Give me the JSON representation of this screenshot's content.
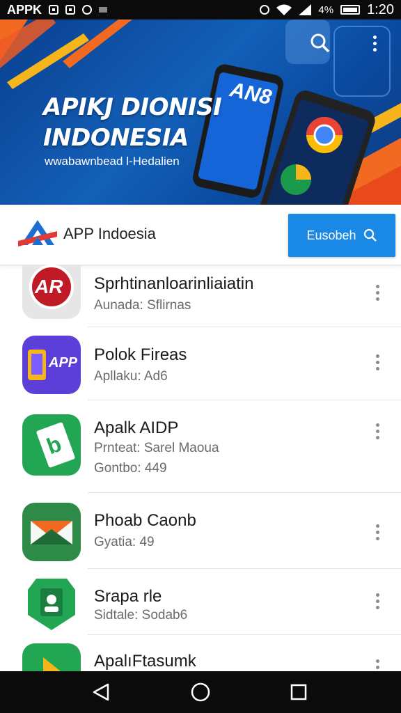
{
  "status_bar": {
    "carrier_label": "APPK",
    "icon_names": [
      "gallery-icon",
      "sim-icon",
      "sync-icon",
      "screenshot-icon"
    ],
    "battery_percent_label": "4%",
    "time": "1:20"
  },
  "hero": {
    "title_line1": "APIKJ DIONISI",
    "title_line2": "INDONESIA",
    "subtitle": "wwabawnbead l-Hedalien",
    "phone_screen_text": "AN8",
    "colors": {
      "background": "#0b4aa0",
      "accent_orange": "#f26a21",
      "accent_yellow": "#f5b51b"
    }
  },
  "app_bar": {
    "app_name": "APP Indoesia",
    "search_button_label": "Eusobeh"
  },
  "list": [
    {
      "icon": "apk-red-icon",
      "title": "Sprhtinanloarinliaiatin",
      "lines": [
        "Aunada: Sflirnas"
      ]
    },
    {
      "icon": "app-purple-icon",
      "icon_text": "APP",
      "title": "Polok Fireas",
      "lines": [
        "Apllaku: Ad6"
      ]
    },
    {
      "icon": "green-b-icon",
      "title": "Apalk AIDP",
      "lines": [
        "Prnteat: Sarel Maoua",
        "Gontbo: 449"
      ]
    },
    {
      "icon": "mail-green-icon",
      "title": "Phoab Caonb",
      "lines": [
        "Gyatia: 49"
      ]
    },
    {
      "icon": "green-shield-icon",
      "title": "Srapa rle",
      "lines": [
        "Sidtale: Sodab6"
      ]
    },
    {
      "icon": "multicolor-icon",
      "title": "ApalıFtasumk",
      "lines": []
    }
  ],
  "nav_bar": {
    "icons": [
      "back-icon",
      "home-icon",
      "recents-icon"
    ]
  }
}
